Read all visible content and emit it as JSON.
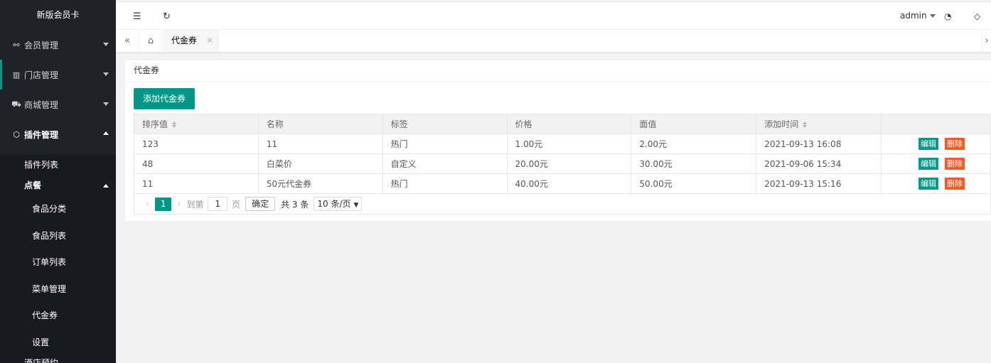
{
  "sidebar": {
    "logo": "新版会员卡",
    "menus": [
      {
        "label": "会员管理",
        "icon": "link-icon"
      },
      {
        "label": "门店管理",
        "icon": "store-icon"
      },
      {
        "label": "商城管理",
        "icon": "cart-icon"
      },
      {
        "label": "插件管理",
        "icon": "cube-icon"
      }
    ],
    "plugin_list": "插件列表",
    "dianke": "点餐",
    "dianke_items": [
      "食品分类",
      "食品列表",
      "订单列表",
      "菜单管理",
      "代金券",
      "设置"
    ],
    "cut_item": "酒店预约"
  },
  "header": {
    "user": "admin"
  },
  "tabs": {
    "active": "代金券"
  },
  "main": {
    "title": "代金券",
    "add_button": "添加代金券",
    "columns": [
      "排序值",
      "名称",
      "标签",
      "价格",
      "面值",
      "添加时间",
      ""
    ],
    "rows": [
      {
        "sort": "123",
        "name": "11",
        "tag": "热门",
        "price": "1.00元",
        "face": "2.00元",
        "time": "2021-09-13 16:08"
      },
      {
        "sort": "48",
        "name": "白菜价",
        "tag": "自定义",
        "price": "20.00元",
        "face": "30.00元",
        "time": "2021-09-06 15:34"
      },
      {
        "sort": "11",
        "name": "50元代金券",
        "tag": "热门",
        "price": "40.00元",
        "face": "50.00元",
        "time": "2021-09-13 15:16"
      }
    ],
    "edit_label": "编辑",
    "delete_label": "删除"
  },
  "pager": {
    "current": "1",
    "goto_label": "到第",
    "page_input": "1",
    "page_unit": "页",
    "confirm": "确定",
    "total": "共 3 条",
    "per_page": "10 条/页"
  },
  "colors": {
    "sidebar_bg": "#20222a",
    "accent": "#009688",
    "danger": "#ff5722"
  }
}
